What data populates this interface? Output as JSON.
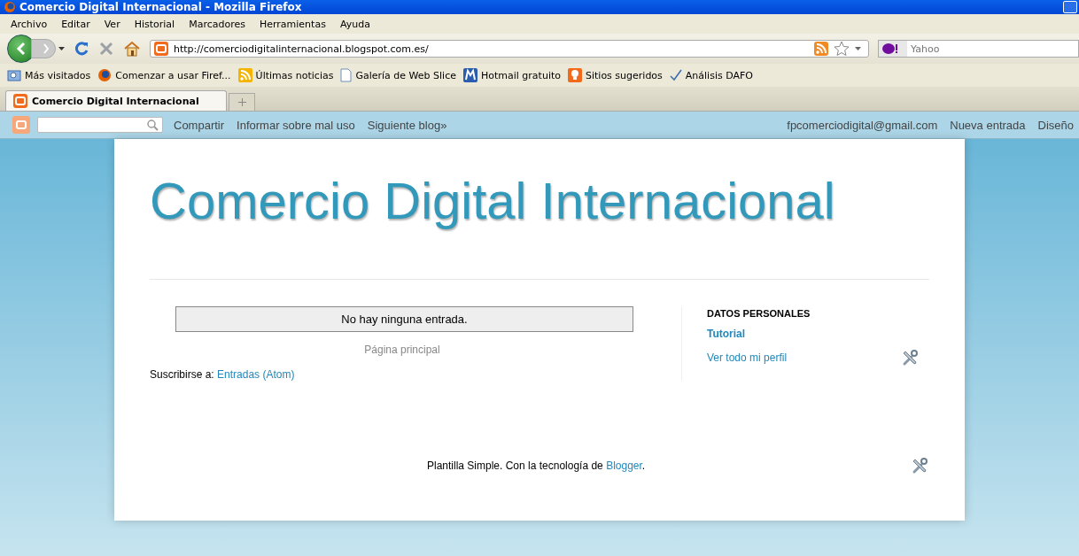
{
  "window": {
    "title": "Comercio Digital Internacional - Mozilla Firefox"
  },
  "menu": [
    "Archivo",
    "Editar",
    "Ver",
    "Historial",
    "Marcadores",
    "Herramientas",
    "Ayuda"
  ],
  "toolbar": {
    "url": "http://comerciodigitalinternacional.blogspot.com.es/",
    "search_placeholder": "Yahoo"
  },
  "bookmarks": [
    {
      "label": "Más visitados",
      "kind": "folder"
    },
    {
      "label": "Comenzar a usar Firef...",
      "kind": "browser"
    },
    {
      "label": "Últimas noticias",
      "kind": "feed"
    },
    {
      "label": "Galería de Web Slice",
      "kind": "page"
    },
    {
      "label": "Hotmail gratuito",
      "kind": "mail"
    },
    {
      "label": "Sitios sugeridos",
      "kind": "bulb"
    },
    {
      "label": "Análisis DAFO",
      "kind": "check"
    }
  ],
  "tabs": [
    {
      "label": "Comercio Digital Internacional",
      "selected": true
    }
  ],
  "navbar": {
    "links": [
      "Compartir",
      "Informar sobre mal uso",
      "Siguiente blog»"
    ],
    "account_links": [
      "fpcomerciodigital@gmail.com",
      "Nueva entrada",
      "Diseño"
    ]
  },
  "blog": {
    "title": "Comercio Digital Internacional",
    "empty_message": "No hay ninguna entrada.",
    "home_link": "Página principal",
    "subscribe_label": "Suscribirse a:",
    "subscribe_link": "Entradas (Atom)"
  },
  "sidebar": {
    "heading": "DATOS PERSONALES",
    "profile_name": "Tutorial",
    "profile_link": "Ver todo mi perfil"
  },
  "footer": {
    "text": "Plantilla Simple. Con la tecnología de",
    "link": "Blogger",
    "suffix": "."
  }
}
